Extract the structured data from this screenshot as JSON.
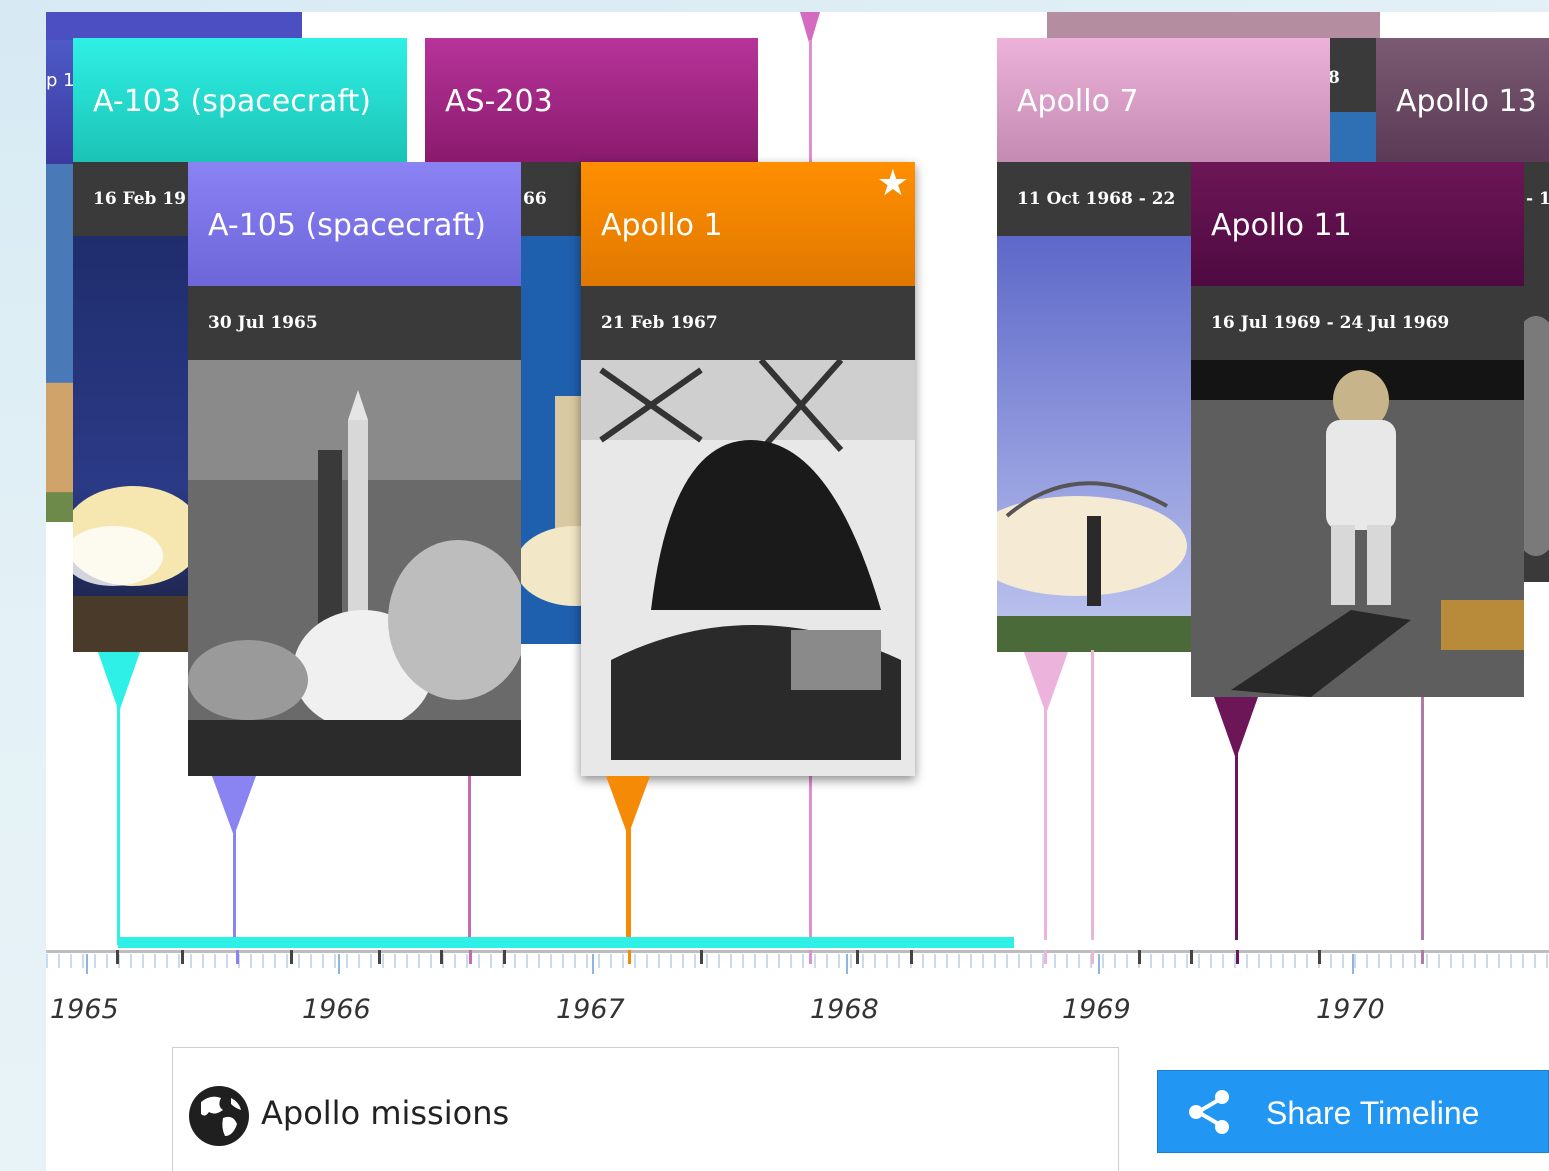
{
  "timeline": {
    "title": "Apollo missions",
    "share_label": "Share Timeline",
    "years": [
      "1965",
      "1966",
      "1967",
      "1968",
      "1969",
      "1970"
    ]
  },
  "cards": {
    "partial_left": {
      "title": "",
      "date": "p 1"
    },
    "a103": {
      "title": "A-103 (spacecraft)",
      "date": "16 Feb 19",
      "color": "#22dcc8"
    },
    "as203": {
      "title": "AS-203",
      "date": "66",
      "color": "#a0267f"
    },
    "a105": {
      "title": "A-105 (spacecraft)",
      "date": "30 Jul 1965",
      "color": "#7a72e6"
    },
    "apollo1": {
      "title": "Apollo 1",
      "date": "21 Feb 1967",
      "color": "#f28a07",
      "favorite": true
    },
    "apollo7": {
      "title": "Apollo 7",
      "date": "11 Oct 1968 - 22",
      "color": "#d9a2c6"
    },
    "partial_8": {
      "title": "",
      "date": "8"
    },
    "apollo13": {
      "title": "Apollo 13",
      "date": "- 1",
      "color": "#6b4a64"
    },
    "apollo11": {
      "title": "Apollo 11",
      "date": "16 Jul 1969 - 24 Jul 1969",
      "color": "#5f0e4c"
    }
  },
  "icons": [
    "globe-icon",
    "share-icon",
    "star-icon"
  ]
}
